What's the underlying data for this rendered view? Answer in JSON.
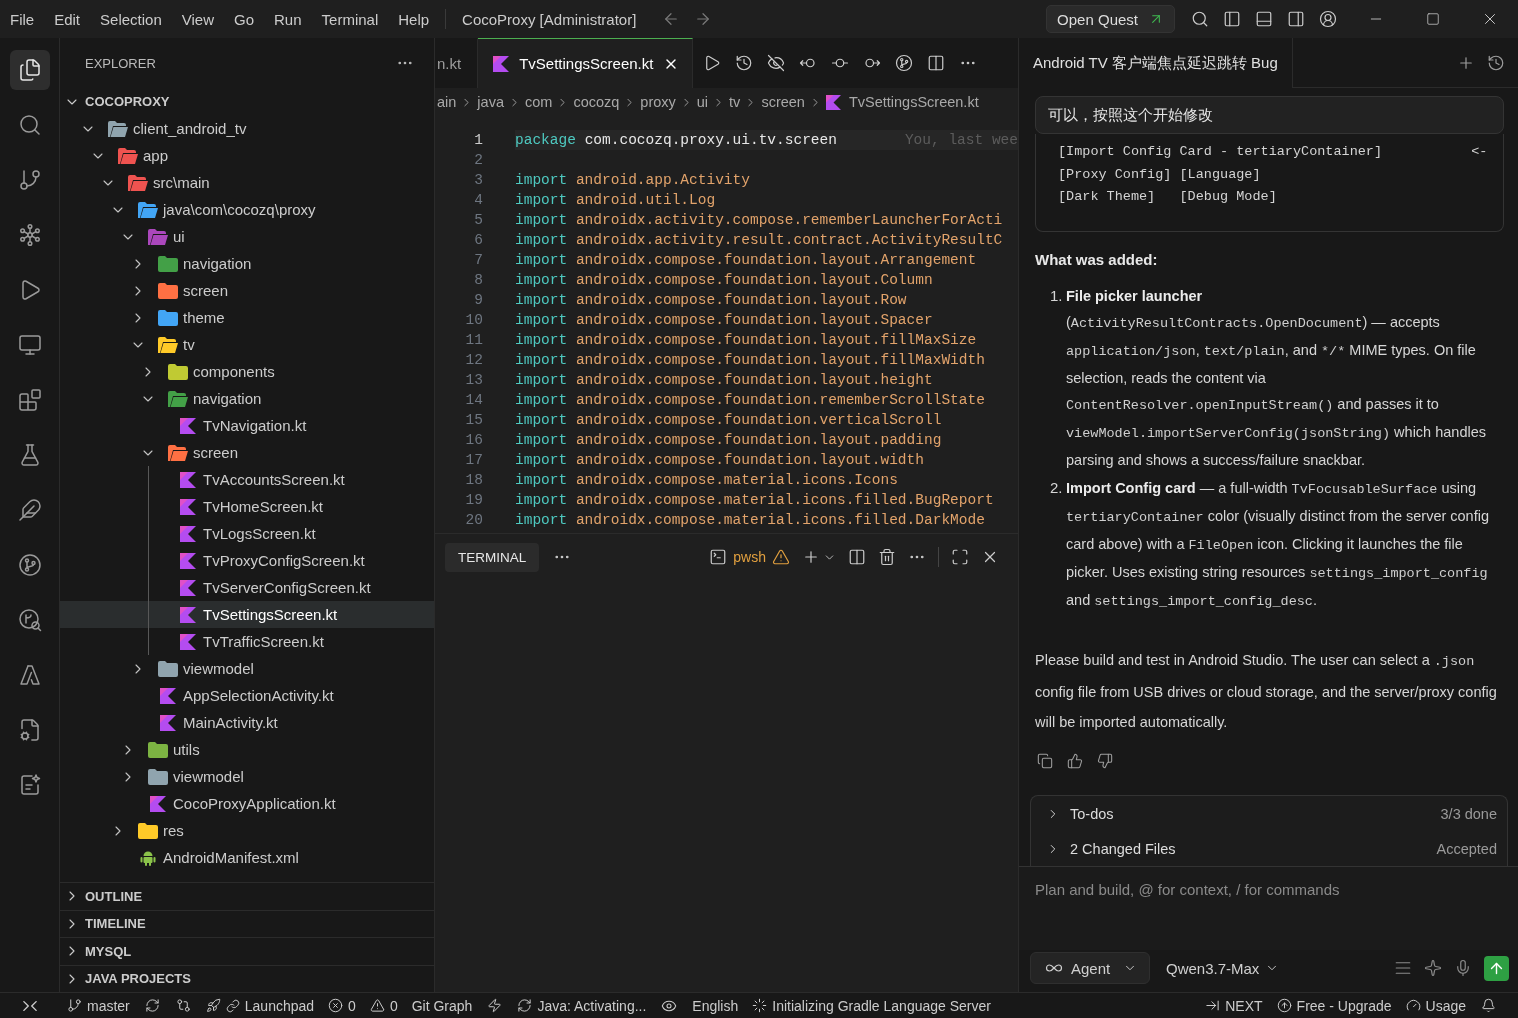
{
  "title_bar": {
    "menu": [
      "File",
      "Edit",
      "Selection",
      "View",
      "Go",
      "Run",
      "Terminal",
      "Help"
    ],
    "title": "CocoProxy [Administrator]",
    "quest_button": "Open Quest"
  },
  "activity_bar": [
    {
      "kind": "explorer",
      "selected": true
    },
    {
      "kind": "search",
      "selected": false
    },
    {
      "kind": "branch",
      "selected": false
    },
    {
      "kind": "nodes",
      "selected": false
    },
    {
      "kind": "run",
      "selected": false
    },
    {
      "kind": "remote",
      "selected": false
    },
    {
      "kind": "extensions",
      "selected": false
    },
    {
      "kind": "testing",
      "selected": false
    },
    {
      "kind": "feather",
      "selected": false
    },
    {
      "kind": "graph",
      "selected": false
    },
    {
      "kind": "branchsearch",
      "selected": false
    },
    {
      "kind": "azure",
      "selected": false
    },
    {
      "kind": "docgear",
      "selected": false
    },
    {
      "kind": "docsparkle",
      "selected": false
    }
  ],
  "sidebar": {
    "title": "EXPLORER",
    "root": {
      "label": "COCOPROXY",
      "expanded": true
    },
    "tree": [
      {
        "label": "client_android_tv",
        "kind": "folder",
        "color": "#90a4ae",
        "expanded": true,
        "selected": false,
        "children": [
          {
            "label": "app",
            "kind": "folder",
            "color": "#ef5350",
            "expanded": true,
            "selected": false,
            "children": [
              {
                "label": "src\\main",
                "kind": "folder",
                "color": "#ef5350",
                "expanded": true,
                "selected": false,
                "children": [
                  {
                    "label": "java\\com\\cocozq\\proxy",
                    "kind": "folder",
                    "color": "#42a5f5",
                    "expanded": true,
                    "selected": false,
                    "children": [
                      {
                        "label": "ui",
                        "kind": "folder",
                        "color": "#ab47bc",
                        "expanded": true,
                        "selected": false,
                        "children": [
                          {
                            "label": "navigation",
                            "kind": "folder",
                            "color": "#43a047",
                            "expanded": false,
                            "selected": false
                          },
                          {
                            "label": "screen",
                            "kind": "folder",
                            "color": "#ff7043",
                            "expanded": false,
                            "selected": false
                          },
                          {
                            "label": "theme",
                            "kind": "folder",
                            "color": "#42a5f5",
                            "expanded": false,
                            "selected": false
                          },
                          {
                            "label": "tv",
                            "kind": "folder",
                            "color": "#ffca28",
                            "expanded": true,
                            "selected": false,
                            "children": [
                              {
                                "label": "components",
                                "kind": "folder",
                                "color": "#c0ca33",
                                "expanded": false,
                                "selected": false
                              },
                              {
                                "label": "navigation",
                                "kind": "folder",
                                "color": "#43a047",
                                "expanded": true,
                                "selected": false,
                                "children": [
                                  {
                                    "label": "TvNavigation.kt",
                                    "kind": "kotlin",
                                    "selected": false
                                  }
                                ]
                              },
                              {
                                "label": "screen",
                                "kind": "folder",
                                "color": "#ff7043",
                                "expanded": true,
                                "selected": false,
                                "children": [
                                  {
                                    "label": "TvAccountsScreen.kt",
                                    "kind": "kotlin",
                                    "selected": false
                                  },
                                  {
                                    "label": "TvHomeScreen.kt",
                                    "kind": "kotlin",
                                    "selected": false
                                  },
                                  {
                                    "label": "TvLogsScreen.kt",
                                    "kind": "kotlin",
                                    "selected": false
                                  },
                                  {
                                    "label": "TvProxyConfigScreen.kt",
                                    "kind": "kotlin",
                                    "selected": false
                                  },
                                  {
                                    "label": "TvServerConfigScreen.kt",
                                    "kind": "kotlin",
                                    "selected": false
                                  },
                                  {
                                    "label": "TvSettingsScreen.kt",
                                    "kind": "kotlin",
                                    "selected": true
                                  },
                                  {
                                    "label": "TvTrafficScreen.kt",
                                    "kind": "kotlin",
                                    "selected": false
                                  }
                                ]
                              }
                            ]
                          },
                          {
                            "label": "viewmodel",
                            "kind": "folder",
                            "color": "#90a4ae",
                            "expanded": false,
                            "selected": false
                          },
                          {
                            "label": "AppSelectionActivity.kt",
                            "kind": "kotlin",
                            "selected": false
                          },
                          {
                            "label": "MainActivity.kt",
                            "kind": "kotlin",
                            "selected": false
                          }
                        ]
                      },
                      {
                        "label": "utils",
                        "kind": "folder",
                        "color": "#7cb342",
                        "expanded": false,
                        "selected": false
                      },
                      {
                        "label": "viewmodel",
                        "kind": "folder",
                        "color": "#90a4ae",
                        "expanded": false,
                        "selected": false
                      },
                      {
                        "label": "CocoProxyApplication.kt",
                        "kind": "kotlin",
                        "selected": false
                      }
                    ]
                  },
                  {
                    "label": "res",
                    "kind": "folder",
                    "color": "#ffca28",
                    "expanded": false,
                    "selected": false
                  },
                  {
                    "label": "AndroidManifest.xml",
                    "kind": "manifest",
                    "selected": false
                  }
                ]
              }
            ]
          }
        ]
      }
    ],
    "sections": [
      {
        "label": "OUTLINE",
        "expanded": false
      },
      {
        "label": "TIMELINE",
        "expanded": false
      },
      {
        "label": "MYSQL",
        "expanded": false
      },
      {
        "label": "JAVA PROJECTS",
        "expanded": false
      }
    ]
  },
  "editor": {
    "tabs": [
      {
        "label": "n.kt",
        "kind": "plain",
        "selected": false
      },
      {
        "label": "TvSettingsScreen.kt",
        "kind": "kotlin",
        "selected": true
      }
    ],
    "breadcrumbs": [
      {
        "label": "ain",
        "kind": "folder"
      },
      {
        "label": "java",
        "kind": "folder"
      },
      {
        "label": "com",
        "kind": "folder"
      },
      {
        "label": "cocozq",
        "kind": "folder"
      },
      {
        "label": "proxy",
        "kind": "folder"
      },
      {
        "label": "ui",
        "kind": "folder"
      },
      {
        "label": "tv",
        "kind": "folder"
      },
      {
        "label": "screen",
        "kind": "folder"
      },
      {
        "label": "TvSettingsScreen.kt",
        "kind": "kotlin"
      }
    ],
    "lines": [
      {
        "number": "1",
        "kind": "package",
        "keyword": "package",
        "path": "com.cocozq.proxy.ui.tv.screen",
        "current": true,
        "blame": "You, last wee"
      },
      {
        "number": "2",
        "kind": "blank",
        "current": false
      },
      {
        "number": "3",
        "kind": "import",
        "keyword": "import",
        "path": "android.app.Activity",
        "current": false
      },
      {
        "number": "4",
        "kind": "import",
        "keyword": "import",
        "path": "android.util.Log",
        "current": false
      },
      {
        "number": "5",
        "kind": "import",
        "keyword": "import",
        "path": "androidx.activity.compose.rememberLauncherForActi",
        "current": false
      },
      {
        "number": "6",
        "kind": "import",
        "keyword": "import",
        "path": "androidx.activity.result.contract.ActivityResultC",
        "current": false
      },
      {
        "number": "7",
        "kind": "import",
        "keyword": "import",
        "path": "androidx.compose.foundation.layout.Arrangement",
        "current": false
      },
      {
        "number": "8",
        "kind": "import",
        "keyword": "import",
        "path": "androidx.compose.foundation.layout.Column",
        "current": false
      },
      {
        "number": "9",
        "kind": "import",
        "keyword": "import",
        "path": "androidx.compose.foundation.layout.Row",
        "current": false
      },
      {
        "number": "10",
        "kind": "import",
        "keyword": "import",
        "path": "androidx.compose.foundation.layout.Spacer",
        "current": false
      },
      {
        "number": "11",
        "kind": "import",
        "keyword": "import",
        "path": "androidx.compose.foundation.layout.fillMaxSize",
        "current": false
      },
      {
        "number": "12",
        "kind": "import",
        "keyword": "import",
        "path": "androidx.compose.foundation.layout.fillMaxWidth",
        "current": false
      },
      {
        "number": "13",
        "kind": "import",
        "keyword": "import",
        "path": "androidx.compose.foundation.layout.height",
        "current": false
      },
      {
        "number": "14",
        "kind": "import",
        "keyword": "import",
        "path": "androidx.compose.foundation.rememberScrollState",
        "current": false
      },
      {
        "number": "15",
        "kind": "import",
        "keyword": "import",
        "path": "androidx.compose.foundation.verticalScroll",
        "current": false
      },
      {
        "number": "16",
        "kind": "import",
        "keyword": "import",
        "path": "androidx.compose.foundation.layout.padding",
        "current": false
      },
      {
        "number": "17",
        "kind": "import",
        "keyword": "import",
        "path": "androidx.compose.foundation.layout.width",
        "current": false
      },
      {
        "number": "18",
        "kind": "import",
        "keyword": "import",
        "path": "androidx.compose.material.icons.Icons",
        "current": false
      },
      {
        "number": "19",
        "kind": "import",
        "keyword": "import",
        "path": "androidx.compose.material.icons.filled.BugReport",
        "current": false
      },
      {
        "number": "20",
        "kind": "import",
        "keyword": "import",
        "path": "androidx.compose.material.icons.filled.DarkMode",
        "current": false
      }
    ]
  },
  "panel": {
    "tabs": [
      {
        "label": "TERMINAL",
        "selected": true
      }
    ],
    "shell": "pwsh"
  },
  "chat": {
    "title": "Android TV 客户端焦点延迟跳转 Bug",
    "user_message": "可以，按照这个开始修改",
    "code_block": [
      "[Import Config Card - tertiaryContainer]           <-",
      "[Proxy Config] [Language]",
      "[Dark Theme]   [Debug Mode]"
    ],
    "heading": "What was added:",
    "list": [
      {
        "number": "1.",
        "segments": [
          {
            "kind": "bold",
            "text": "File picker launcher"
          },
          {
            "kind": "text",
            "text": " ("
          },
          {
            "kind": "code",
            "text": "ActivityResultContracts.OpenDocument"
          },
          {
            "kind": "text",
            "text": ") — accepts "
          },
          {
            "kind": "code",
            "text": "application/json"
          },
          {
            "kind": "text",
            "text": ", "
          },
          {
            "kind": "code",
            "text": "text/plain"
          },
          {
            "kind": "text",
            "text": ", and "
          },
          {
            "kind": "code",
            "text": "*/*"
          },
          {
            "kind": "text",
            "text": " MIME types. On file selection, reads the content via "
          },
          {
            "kind": "code",
            "text": "ContentResolver.openInputStream()"
          },
          {
            "kind": "text",
            "text": " and passes it to "
          },
          {
            "kind": "code",
            "text": "viewModel.importServerConfig(jsonString)"
          },
          {
            "kind": "text",
            "text": " which handles parsing and shows a success/failure snackbar."
          }
        ]
      },
      {
        "number": "2.",
        "segments": [
          {
            "kind": "bold",
            "text": "Import Config card"
          },
          {
            "kind": "text",
            "text": " — a full-width "
          },
          {
            "kind": "code",
            "text": "TvFocusableSurface"
          },
          {
            "kind": "text",
            "text": " using "
          },
          {
            "kind": "code",
            "text": "tertiaryContainer"
          },
          {
            "kind": "text",
            "text": " color (visually distinct from the server config card above) with a "
          },
          {
            "kind": "code",
            "text": "FileOpen"
          },
          {
            "kind": "text",
            "text": " icon. Clicking it launches the file picker. Uses existing string resources "
          },
          {
            "kind": "code",
            "text": "settings_import_config"
          },
          {
            "kind": "text",
            "text": " and "
          },
          {
            "kind": "code",
            "text": "settings_import_config_desc"
          },
          {
            "kind": "text",
            "text": "."
          }
        ]
      }
    ],
    "closing": [
      {
        "kind": "text",
        "text": "Please build and test in Android Studio. The user can select a "
      },
      {
        "kind": "code",
        "text": ".json"
      },
      {
        "kind": "text",
        "text": " config file from USB drives or cloud storage, and the server/proxy config will be imported automatically."
      }
    ],
    "summary": [
      {
        "label": "To-dos",
        "status": "3/3 done",
        "expanded": false
      },
      {
        "label": "2 Changed Files",
        "status": "Accepted",
        "expanded": false
      }
    ],
    "input": {
      "placeholder": "Plan and build, @ for context, / for commands"
    },
    "mode": "Agent",
    "model": "Qwen3.7-Max"
  },
  "status_bar": {
    "branch": "master",
    "launchpad": "Launchpad",
    "errors": "0",
    "warnings": "0",
    "git_graph": "Git Graph",
    "java": "Java: Activating...",
    "language": "English",
    "gradle": "Initializing Gradle Language Server",
    "next": "NEXT",
    "upgrade": "Free - Upgrade",
    "usage": "Usage"
  }
}
